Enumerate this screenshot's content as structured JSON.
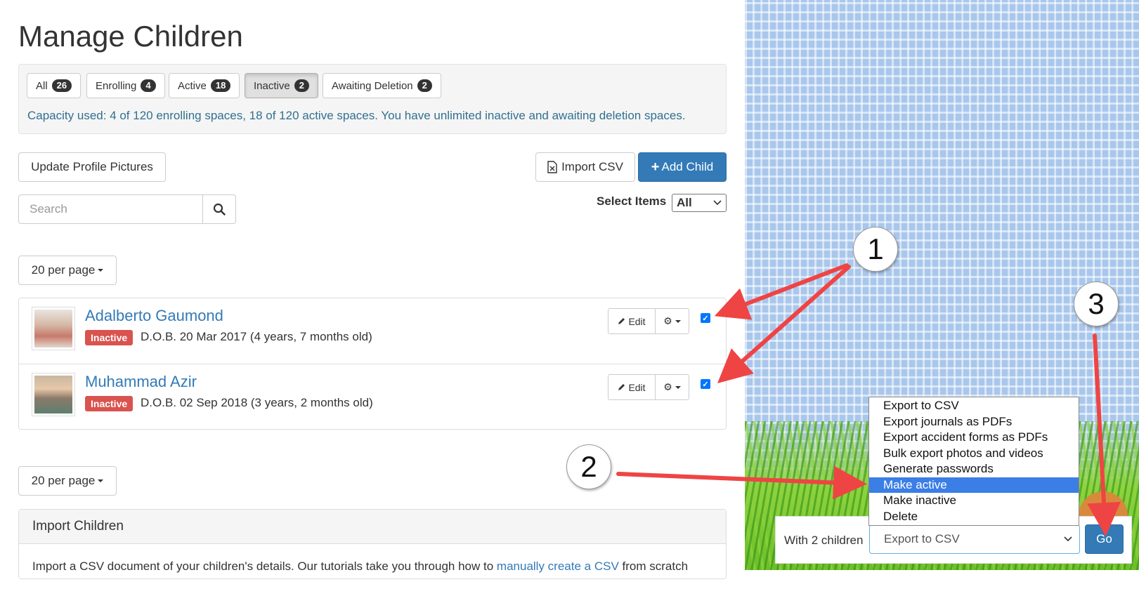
{
  "page": {
    "title": "Manage Children"
  },
  "filters": {
    "tabs": [
      {
        "label": "All",
        "count": "26",
        "active": false
      },
      {
        "label": "Enrolling",
        "count": "4",
        "active": false
      },
      {
        "label": "Active",
        "count": "18",
        "active": false
      },
      {
        "label": "Inactive",
        "count": "2",
        "active": true
      },
      {
        "label": "Awaiting Deletion",
        "count": "2",
        "active": false
      }
    ],
    "capacity_text": "Capacity used: 4 of 120 enrolling spaces, 18 of 120 active spaces. You have unlimited inactive and awaiting deletion spaces."
  },
  "toolbar": {
    "update_pictures_label": "Update Profile Pictures",
    "import_csv_label": "Import CSV",
    "add_child_label": "Add Child",
    "search_placeholder": "Search",
    "select_items_label": "Select Items",
    "select_items_value": "All",
    "per_page_label": "20 per page"
  },
  "children": [
    {
      "name": "Adalberto Gaumond",
      "status": "Inactive",
      "dob": "D.O.B. 20 Mar 2017 (4 years, 7 months old)",
      "edit_label": "Edit",
      "checked": true
    },
    {
      "name": "Muhammad Azir",
      "status": "Inactive",
      "dob": "D.O.B. 02 Sep 2018 (3 years, 2 months old)",
      "edit_label": "Edit",
      "checked": true
    }
  ],
  "import_panel": {
    "title": "Import Children",
    "body_prefix": "Import a CSV document of your children's details. Our tutorials take you through how to ",
    "link_text": "manually create a CSV",
    "body_suffix": " from scratch"
  },
  "bulk_action": {
    "with_label": "With 2 children",
    "selected": "Export to CSV",
    "go_label": "Go",
    "options": [
      "Export to CSV",
      "Export journals as PDFs",
      "Export accident forms as PDFs",
      "Bulk export photos and videos",
      "Generate passwords",
      "Make active",
      "Make inactive",
      "Delete"
    ],
    "highlighted_option": "Make active"
  },
  "annotations": {
    "callout_1": "1",
    "callout_2": "2",
    "callout_3": "3"
  },
  "colors": {
    "primary": "#337ab7",
    "danger": "#d9534f",
    "info_text": "#31708f",
    "arrow": "#ef4444"
  }
}
